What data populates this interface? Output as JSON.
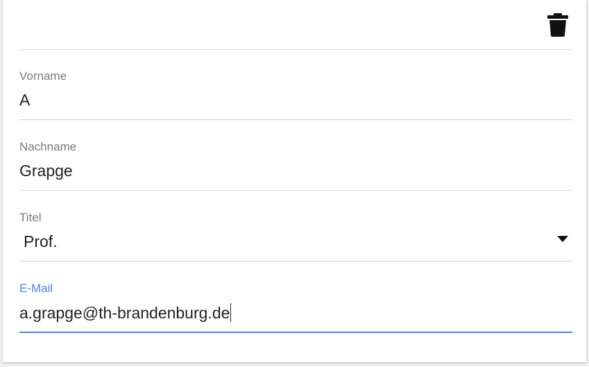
{
  "toolbar": {
    "delete_icon": "trash-icon"
  },
  "form": {
    "vorname": {
      "label": "Vorname",
      "value": "A"
    },
    "nachname": {
      "label": "Nachname",
      "value": "Grapge"
    },
    "titel": {
      "label": "Titel",
      "value": "Prof.",
      "icon": "dropdown-arrow-icon"
    },
    "email": {
      "label": "E-Mail",
      "value": "a.grapge@th-brandenburg.de"
    }
  },
  "colors": {
    "accent": "#4a86e0",
    "label": "#7a7a7a",
    "text": "#212121",
    "divider": "#d6d6d6"
  }
}
